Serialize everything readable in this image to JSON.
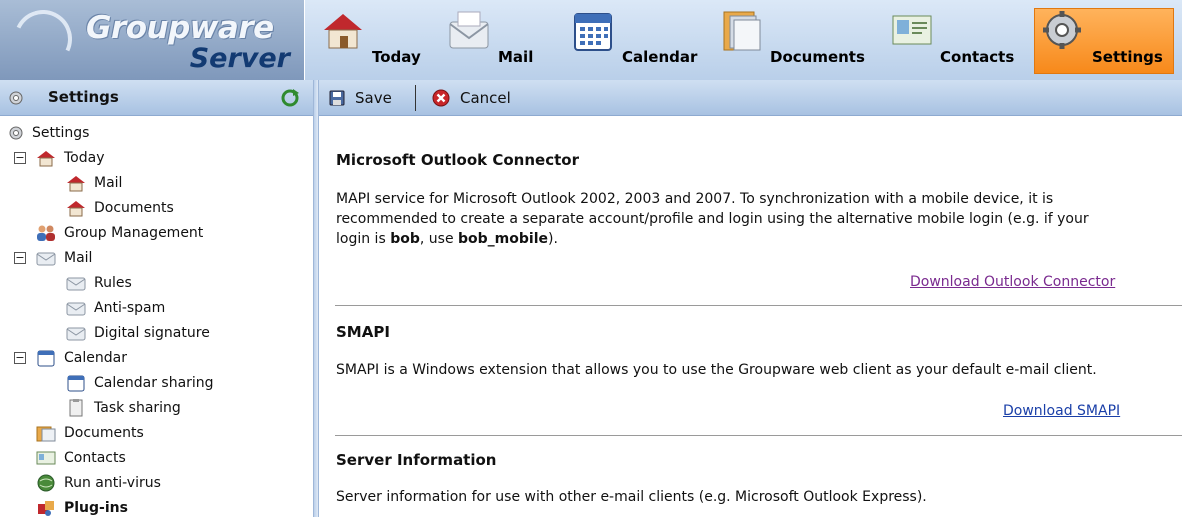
{
  "app": {
    "logo_line1": "Groupware",
    "logo_line2": "Server"
  },
  "nav": {
    "today": "Today",
    "mail": "Mail",
    "calendar": "Calendar",
    "documents": "Documents",
    "contacts": "Contacts",
    "settings": "Settings"
  },
  "left_panel": {
    "title": "Settings"
  },
  "tree": {
    "settings": "Settings",
    "today": "Today",
    "today_mail": "Mail",
    "today_documents": "Documents",
    "group_management": "Group Management",
    "mail": "Mail",
    "rules": "Rules",
    "anti_spam": "Anti-spam",
    "digital_signature": "Digital signature",
    "calendar": "Calendar",
    "calendar_sharing": "Calendar sharing",
    "task_sharing": "Task sharing",
    "documents": "Documents",
    "contacts": "Contacts",
    "run_antivirus": "Run anti-virus",
    "plugins": "Plug-ins"
  },
  "toolbar": {
    "save": "Save",
    "cancel": "Cancel"
  },
  "sections": {
    "outlook": {
      "title": "Microsoft Outlook Connector",
      "text_before_bob": "MAPI service for Microsoft Outlook 2002, 2003 and 2007. To synchronization with a mobile device, it is recommended to create a separate account/profile and login using the alternative mobile login (e.g. if your login is ",
      "bold1": "bob",
      "text_mid": ", use ",
      "bold2": "bob_mobile",
      "text_end": ").",
      "link": "Download Outlook Connector"
    },
    "smapi": {
      "title": "SMAPI",
      "text": "SMAPI is a Windows extension that allows you to use the Groupware web client as your default e-mail client.",
      "link": "Download SMAPI"
    },
    "server": {
      "title": "Server Information",
      "text": "Server information for use with other e-mail clients (e.g. Microsoft Outlook Express)."
    }
  },
  "colors": {
    "header_bg": "#c7d9ef",
    "settings_tab": "#f7891a",
    "link_visited": "#7a2a8f",
    "link": "#1a3fa8"
  }
}
